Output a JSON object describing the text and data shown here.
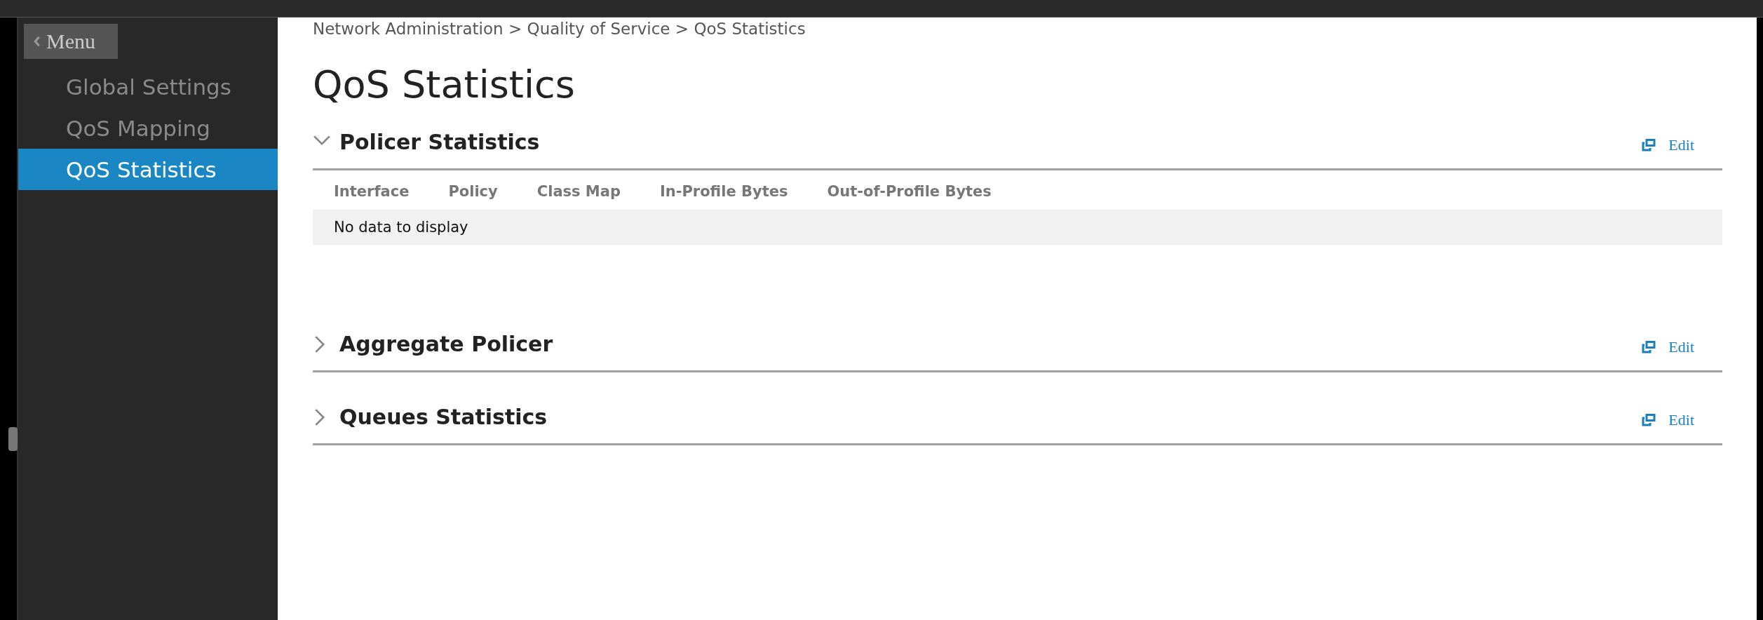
{
  "sidebar": {
    "menu_button": "Menu",
    "items": [
      {
        "label": "Global Settings",
        "selected": false
      },
      {
        "label": "QoS Mapping",
        "selected": false
      },
      {
        "label": "QoS Statistics",
        "selected": true
      }
    ]
  },
  "breadcrumb": "Network Administration > Quality of Service > QoS Statistics",
  "title": "QoS Statistics",
  "sections": [
    {
      "title": "Policer Statistics",
      "expanded": true,
      "edit_label": "Edit",
      "table": {
        "columns": [
          "Interface",
          "Policy",
          "Class Map",
          "In-Profile Bytes",
          "Out-of-Profile Bytes"
        ],
        "empty_message": "No data to display"
      }
    },
    {
      "title": "Aggregate Policer",
      "expanded": false,
      "edit_label": "Edit"
    },
    {
      "title": "Queues Statistics",
      "expanded": false,
      "edit_label": "Edit"
    }
  ]
}
